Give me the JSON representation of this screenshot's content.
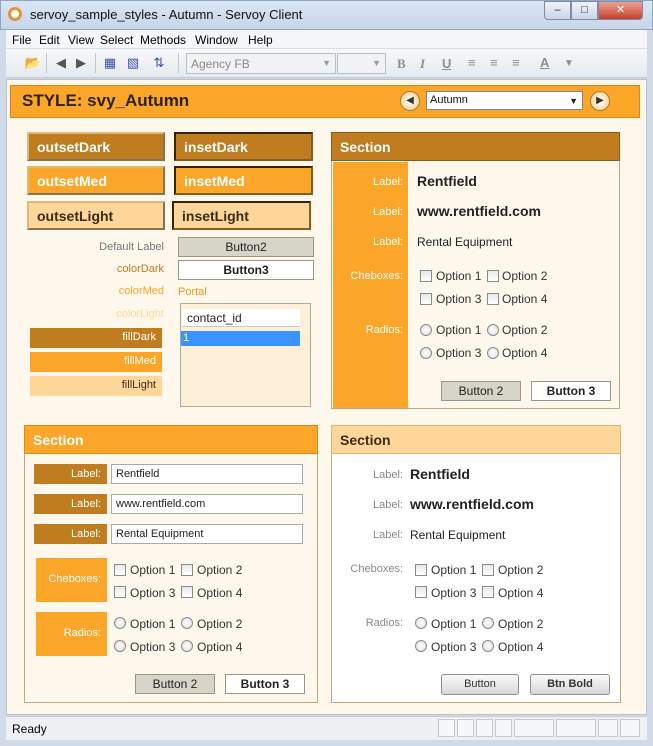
{
  "window": {
    "title": "servoy_sample_styles - Autumn - Servoy Client",
    "minimize": "–",
    "maximize": "□",
    "close": "✕"
  },
  "menu": [
    "File",
    "Edit",
    "View",
    "Select",
    "Methods",
    "Window",
    "Help"
  ],
  "toolbar": {
    "font_value": "Agency FB",
    "icons": [
      "open-folder-icon",
      "back-arrow-icon",
      "forward-arrow-icon",
      "grid-icon",
      "delete-grid-icon",
      "sort-icon",
      "bold-icon",
      "italic-icon",
      "underline-icon",
      "align-left-icon",
      "align-center-icon",
      "align-right-icon",
      "font-color-icon"
    ]
  },
  "header": {
    "title": "STYLE: svy_Autumn",
    "selected_style": "Autumn",
    "prev": "◀",
    "next": "▶"
  },
  "styles": {
    "outsetDark": "outsetDark",
    "insetDark": "insetDark",
    "outsetMed": "outsetMed",
    "insetMed": "insetMed",
    "outsetLight": "outsetLight",
    "insetLight": "insetLight",
    "default_label": "Default Label",
    "button2": "Button2",
    "colorDark": "colorDark",
    "button3": "Button3",
    "colorMed": "colorMed",
    "portal": "Portal",
    "colorLight": "colorLight",
    "fillDark": "fillDark",
    "fillMed": "fillMed",
    "fillLight": "fillLight",
    "portal_column": "contact_id",
    "portal_row_value": "1"
  },
  "section_label": "Section",
  "fields": {
    "label": "Label:",
    "company": "Rentfield",
    "website": "www.rentfield.com",
    "business": "Rental Equipment",
    "checkboxes": "Cheboxes:",
    "radios": "Radios:",
    "options": [
      "Option 1",
      "Option 2",
      "Option 3",
      "Option 4"
    ]
  },
  "buttons": {
    "button_2": "Button 2",
    "button_3": "Button 3",
    "button": "Button",
    "btn_bold": "Btn Bold"
  },
  "status": "Ready",
  "colors": {
    "dark": "#c07d1f",
    "med": "#fba628",
    "light": "#ffd699",
    "background": "#fef7ec"
  }
}
